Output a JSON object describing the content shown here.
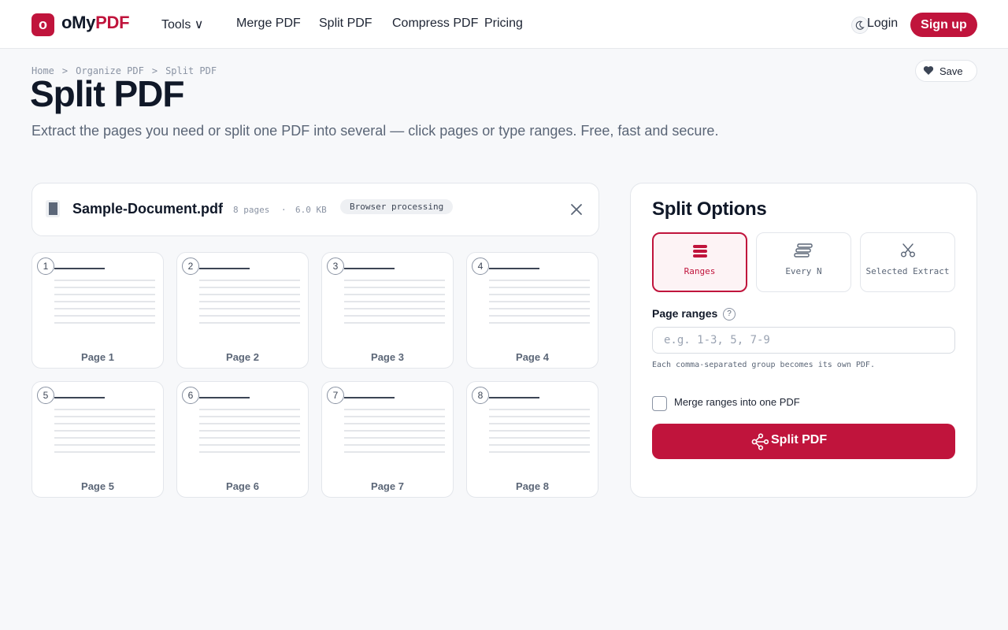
{
  "header": {
    "logo_mark": "o",
    "logo_primary": "oMy",
    "logo_accent": "PDF",
    "nav": [
      "Tools ∨",
      "Merge PDF",
      "Split PDF",
      "Compress PDF",
      "Pricing"
    ],
    "login": "Login",
    "signup": "Sign up"
  },
  "breadcrumb": [
    "Home",
    ">",
    "Organize PDF",
    ">",
    "Split PDF"
  ],
  "title": "Split PDF",
  "save_label": "Save",
  "subtitle": "Extract the pages you need or split one PDF into several — click pages or type ranges. Free, fast and secure.",
  "file": {
    "name": "Sample-Document.pdf",
    "dot": "·",
    "pages": "8 pages",
    "size": "6.0 KB",
    "badge": "Browser processing"
  },
  "pages": [
    {
      "num": "1",
      "label": "Page 1"
    },
    {
      "num": "2",
      "label": "Page 2"
    },
    {
      "num": "3",
      "label": "Page 3"
    },
    {
      "num": "4",
      "label": "Page 4"
    },
    {
      "num": "5",
      "label": "Page 5"
    },
    {
      "num": "6",
      "label": "Page 6"
    },
    {
      "num": "7",
      "label": "Page 7"
    },
    {
      "num": "8",
      "label": "Page 8"
    }
  ],
  "options": {
    "title": "Split Options",
    "modes": [
      {
        "label": "Ranges",
        "icon": "ranges-icon",
        "active": true
      },
      {
        "label": "Every N",
        "icon": "every-n-icon",
        "active": false
      },
      {
        "label": "Selected Extract",
        "icon": "scissors-icon",
        "active": false
      }
    ],
    "field_label": "Page ranges",
    "help": "?",
    "placeholder": "e.g. 1-3, 5, 7-9",
    "value": "",
    "hint": "Each comma-separated group becomes its own PDF.",
    "merge_label": "Merge ranges into one PDF",
    "merge_checked": false,
    "button": "Split PDF"
  },
  "colors": {
    "accent": "#c0143c",
    "text": "#101828",
    "muted": "#5b6677",
    "background": "#f7f8fa"
  }
}
